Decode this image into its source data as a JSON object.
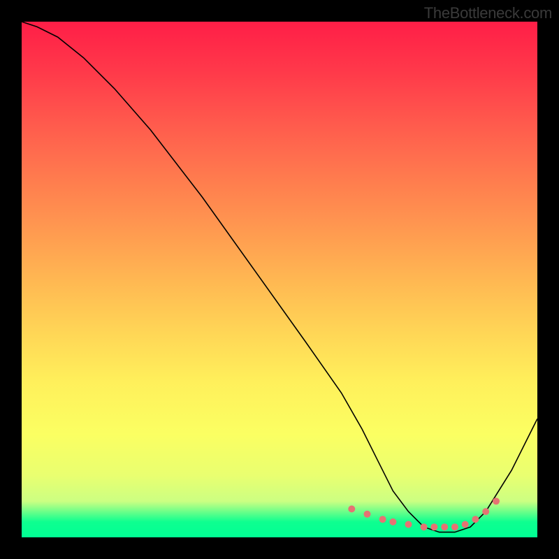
{
  "watermark": "TheBottleneck.com",
  "chart_data": {
    "type": "line",
    "title": "",
    "xlabel": "",
    "ylabel": "",
    "xlim": [
      0,
      100
    ],
    "ylim": [
      0,
      100
    ],
    "series": [
      {
        "name": "curve",
        "x": [
          0,
          3,
          7,
          12,
          18,
          25,
          35,
          45,
          55,
          62,
          66,
          69,
          72,
          75,
          78,
          81,
          84,
          87,
          90,
          95,
          100
        ],
        "y": [
          100,
          99,
          97,
          93,
          87,
          79,
          66,
          52,
          38,
          28,
          21,
          15,
          9,
          5,
          2,
          1,
          1,
          2,
          5,
          13,
          23
        ]
      }
    ],
    "markers": {
      "name": "highlight-points",
      "color": "#e57373",
      "x": [
        64,
        67,
        70,
        72,
        75,
        78,
        80,
        82,
        84,
        86,
        88,
        90,
        92
      ],
      "y": [
        5.5,
        4.5,
        3.5,
        3,
        2.5,
        2,
        2,
        2,
        2,
        2.5,
        3.5,
        5,
        7
      ]
    }
  }
}
